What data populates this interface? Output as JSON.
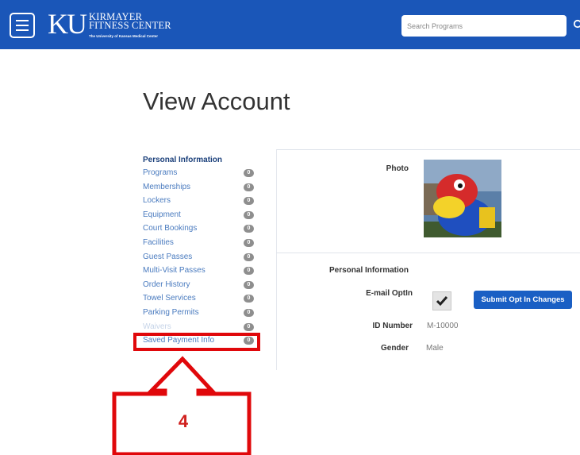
{
  "header": {
    "logo_mark": "KU",
    "logo_line1": "KIRMAYER",
    "logo_line2": "FITNESS CENTER",
    "logo_sub": "The University of Kansas Medical Center",
    "search_placeholder": "Search Programs"
  },
  "page": {
    "title": "View Account"
  },
  "sidebar": {
    "heading": "Personal Information",
    "items": [
      {
        "label": "Programs",
        "count": "0"
      },
      {
        "label": "Memberships",
        "count": "0"
      },
      {
        "label": "Lockers",
        "count": "0"
      },
      {
        "label": "Equipment",
        "count": "0"
      },
      {
        "label": "Court Bookings",
        "count": "0"
      },
      {
        "label": "Facilities",
        "count": "0"
      },
      {
        "label": "Guest Passes",
        "count": "0"
      },
      {
        "label": "Multi-Visit Passes",
        "count": "0"
      },
      {
        "label": "Order History",
        "count": "0"
      },
      {
        "label": "Towel Services",
        "count": "0"
      },
      {
        "label": "Parking Permits",
        "count": "0"
      },
      {
        "label": "Waivers",
        "count": "0"
      },
      {
        "label": "Saved Payment Info",
        "count": "0"
      }
    ]
  },
  "account": {
    "photo_label": "Photo",
    "section_heading": "Personal Information",
    "email_optin_label": "E-mail OptIn",
    "email_optin_checked": true,
    "submit_label": "Submit Opt In Changes",
    "id_label": "ID Number",
    "id_value": "M-10000",
    "gender_label": "Gender",
    "gender_value": "Male"
  },
  "annotation": {
    "step_number": "4",
    "color": "#e0080b"
  },
  "colors": {
    "header": "#1a56b8",
    "link": "#4a7bbf",
    "button": "#1a5fc4",
    "badge": "#8e8e8e"
  }
}
